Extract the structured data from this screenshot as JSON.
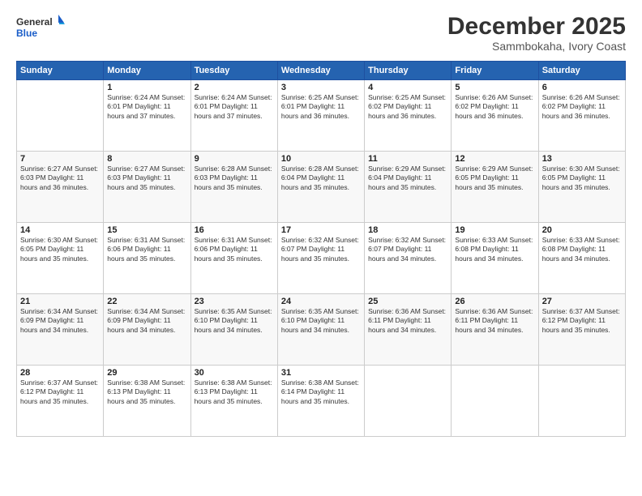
{
  "logo": {
    "line1": "General",
    "line2": "Blue"
  },
  "title": "December 2025",
  "location": "Sammbokaha, Ivory Coast",
  "header_days": [
    "Sunday",
    "Monday",
    "Tuesday",
    "Wednesday",
    "Thursday",
    "Friday",
    "Saturday"
  ],
  "weeks": [
    [
      {
        "day": "",
        "info": ""
      },
      {
        "day": "1",
        "info": "Sunrise: 6:24 AM\nSunset: 6:01 PM\nDaylight: 11 hours\nand 37 minutes."
      },
      {
        "day": "2",
        "info": "Sunrise: 6:24 AM\nSunset: 6:01 PM\nDaylight: 11 hours\nand 37 minutes."
      },
      {
        "day": "3",
        "info": "Sunrise: 6:25 AM\nSunset: 6:01 PM\nDaylight: 11 hours\nand 36 minutes."
      },
      {
        "day": "4",
        "info": "Sunrise: 6:25 AM\nSunset: 6:02 PM\nDaylight: 11 hours\nand 36 minutes."
      },
      {
        "day": "5",
        "info": "Sunrise: 6:26 AM\nSunset: 6:02 PM\nDaylight: 11 hours\nand 36 minutes."
      },
      {
        "day": "6",
        "info": "Sunrise: 6:26 AM\nSunset: 6:02 PM\nDaylight: 11 hours\nand 36 minutes."
      }
    ],
    [
      {
        "day": "7",
        "info": "Sunrise: 6:27 AM\nSunset: 6:03 PM\nDaylight: 11 hours\nand 36 minutes."
      },
      {
        "day": "8",
        "info": "Sunrise: 6:27 AM\nSunset: 6:03 PM\nDaylight: 11 hours\nand 35 minutes."
      },
      {
        "day": "9",
        "info": "Sunrise: 6:28 AM\nSunset: 6:03 PM\nDaylight: 11 hours\nand 35 minutes."
      },
      {
        "day": "10",
        "info": "Sunrise: 6:28 AM\nSunset: 6:04 PM\nDaylight: 11 hours\nand 35 minutes."
      },
      {
        "day": "11",
        "info": "Sunrise: 6:29 AM\nSunset: 6:04 PM\nDaylight: 11 hours\nand 35 minutes."
      },
      {
        "day": "12",
        "info": "Sunrise: 6:29 AM\nSunset: 6:05 PM\nDaylight: 11 hours\nand 35 minutes."
      },
      {
        "day": "13",
        "info": "Sunrise: 6:30 AM\nSunset: 6:05 PM\nDaylight: 11 hours\nand 35 minutes."
      }
    ],
    [
      {
        "day": "14",
        "info": "Sunrise: 6:30 AM\nSunset: 6:05 PM\nDaylight: 11 hours\nand 35 minutes."
      },
      {
        "day": "15",
        "info": "Sunrise: 6:31 AM\nSunset: 6:06 PM\nDaylight: 11 hours\nand 35 minutes."
      },
      {
        "day": "16",
        "info": "Sunrise: 6:31 AM\nSunset: 6:06 PM\nDaylight: 11 hours\nand 35 minutes."
      },
      {
        "day": "17",
        "info": "Sunrise: 6:32 AM\nSunset: 6:07 PM\nDaylight: 11 hours\nand 35 minutes."
      },
      {
        "day": "18",
        "info": "Sunrise: 6:32 AM\nSunset: 6:07 PM\nDaylight: 11 hours\nand 34 minutes."
      },
      {
        "day": "19",
        "info": "Sunrise: 6:33 AM\nSunset: 6:08 PM\nDaylight: 11 hours\nand 34 minutes."
      },
      {
        "day": "20",
        "info": "Sunrise: 6:33 AM\nSunset: 6:08 PM\nDaylight: 11 hours\nand 34 minutes."
      }
    ],
    [
      {
        "day": "21",
        "info": "Sunrise: 6:34 AM\nSunset: 6:09 PM\nDaylight: 11 hours\nand 34 minutes."
      },
      {
        "day": "22",
        "info": "Sunrise: 6:34 AM\nSunset: 6:09 PM\nDaylight: 11 hours\nand 34 minutes."
      },
      {
        "day": "23",
        "info": "Sunrise: 6:35 AM\nSunset: 6:10 PM\nDaylight: 11 hours\nand 34 minutes."
      },
      {
        "day": "24",
        "info": "Sunrise: 6:35 AM\nSunset: 6:10 PM\nDaylight: 11 hours\nand 34 minutes."
      },
      {
        "day": "25",
        "info": "Sunrise: 6:36 AM\nSunset: 6:11 PM\nDaylight: 11 hours\nand 34 minutes."
      },
      {
        "day": "26",
        "info": "Sunrise: 6:36 AM\nSunset: 6:11 PM\nDaylight: 11 hours\nand 34 minutes."
      },
      {
        "day": "27",
        "info": "Sunrise: 6:37 AM\nSunset: 6:12 PM\nDaylight: 11 hours\nand 35 minutes."
      }
    ],
    [
      {
        "day": "28",
        "info": "Sunrise: 6:37 AM\nSunset: 6:12 PM\nDaylight: 11 hours\nand 35 minutes."
      },
      {
        "day": "29",
        "info": "Sunrise: 6:38 AM\nSunset: 6:13 PM\nDaylight: 11 hours\nand 35 minutes."
      },
      {
        "day": "30",
        "info": "Sunrise: 6:38 AM\nSunset: 6:13 PM\nDaylight: 11 hours\nand 35 minutes."
      },
      {
        "day": "31",
        "info": "Sunrise: 6:38 AM\nSunset: 6:14 PM\nDaylight: 11 hours\nand 35 minutes."
      },
      {
        "day": "",
        "info": ""
      },
      {
        "day": "",
        "info": ""
      },
      {
        "day": "",
        "info": ""
      }
    ]
  ]
}
